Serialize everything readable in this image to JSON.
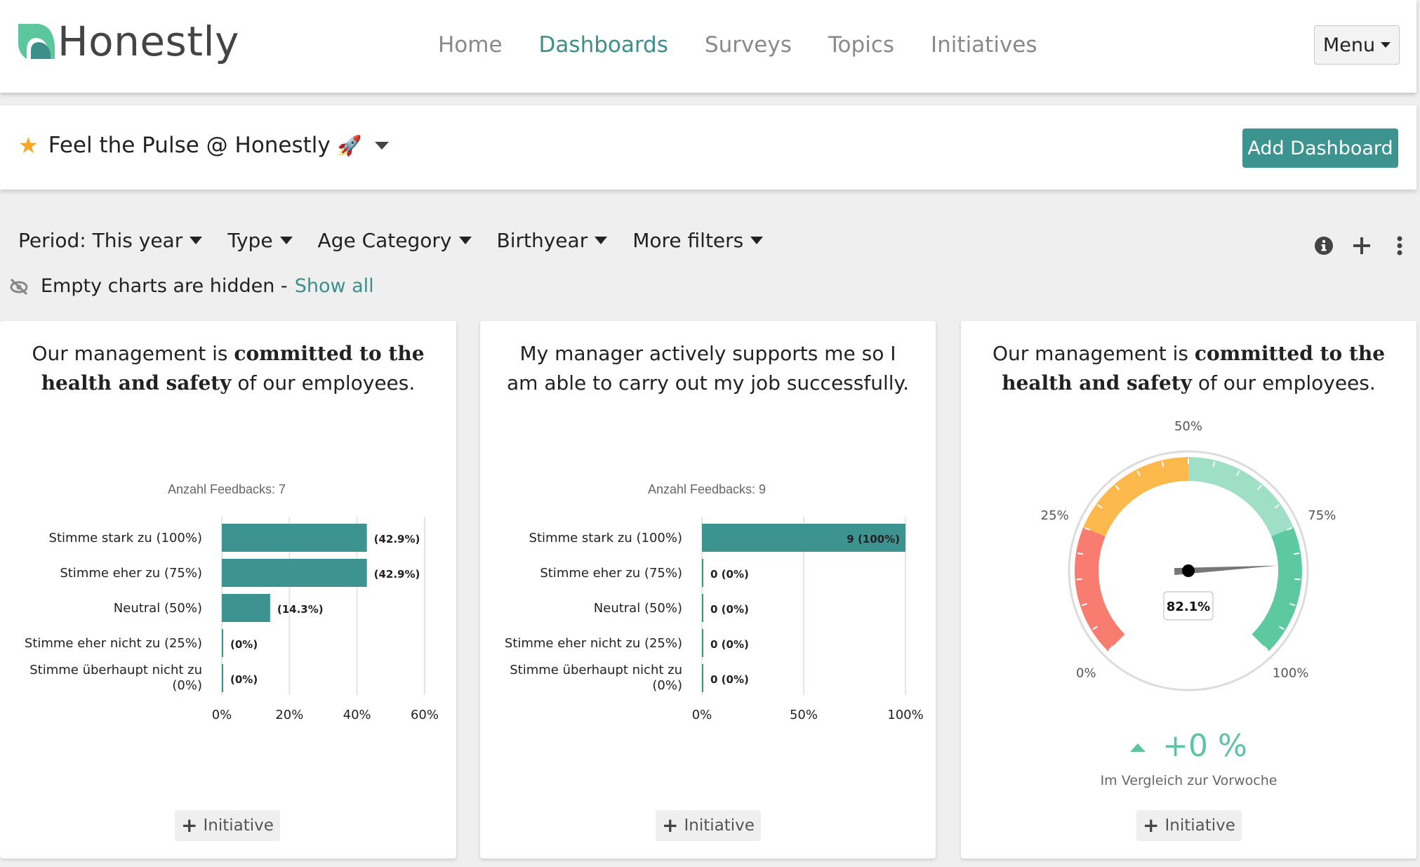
{
  "brand": {
    "name": "Honestly",
    "accent": "#3d9390",
    "logo_light": "#5cc79c",
    "logo_dark": "#3d8f8c"
  },
  "nav": {
    "links": [
      {
        "label": "Home",
        "active": false
      },
      {
        "label": "Dashboards",
        "active": true
      },
      {
        "label": "Surveys",
        "active": false
      },
      {
        "label": "Topics",
        "active": false
      },
      {
        "label": "Initiatives",
        "active": false
      }
    ],
    "menu_label": "Menu"
  },
  "dashboard": {
    "star_icon": "star-icon",
    "title": "Feel the Pulse @ Honestly",
    "emoji": "🚀",
    "add_label": "Add Dashboard"
  },
  "filters": [
    {
      "label": "Period: This year"
    },
    {
      "label": "Type"
    },
    {
      "label": "Age Category"
    },
    {
      "label": "Birthyear"
    },
    {
      "label": "More filters"
    }
  ],
  "tools": {
    "info_icon": "info-icon",
    "add_icon": "plus-icon",
    "more_icon": "more-vertical-icon"
  },
  "empty_note": {
    "text": "Empty charts are hidden -",
    "link": "Show all"
  },
  "cards": [
    {
      "title_pre": "Our management is ",
      "title_bold": "committed to the health and safety",
      "title_post": " of our employees.",
      "initiative_label": "Initiative"
    },
    {
      "title_pre": "My manager actively supports me so I am able to carry out my job successfully.",
      "title_bold": "",
      "title_post": "",
      "initiative_label": "Initiative"
    },
    {
      "title_pre": "Our management is ",
      "title_bold": "committed to the health and safety",
      "title_post": " of our employees.",
      "initiative_label": "Initiative",
      "trend_value": "+0 %",
      "trend_note": "Im Vergleich zur Vorwoche"
    }
  ],
  "chart_data": [
    {
      "type": "bar",
      "orientation": "horizontal",
      "title": "Anzahl Feedbacks: 7",
      "categories": [
        "Stimme stark zu (100%)",
        "Stimme eher zu (75%)",
        "Neutral (50%)",
        "Stimme eher nicht zu (25%)",
        "Stimme überhaupt nicht zu (0%)"
      ],
      "values": [
        42.9,
        42.9,
        14.3,
        0,
        0
      ],
      "data_labels": [
        "(42.9%)",
        "(42.9%)",
        "(14.3%)",
        "(0%)",
        "(0%)"
      ],
      "xticks": [
        "0%",
        "20%",
        "40%",
        "60%"
      ],
      "xlim": [
        0,
        60
      ],
      "grid": true,
      "color": "#3d9390"
    },
    {
      "type": "bar",
      "orientation": "horizontal",
      "title": "Anzahl Feedbacks: 9",
      "categories": [
        "Stimme stark zu (100%)",
        "Stimme eher zu (75%)",
        "Neutral (50%)",
        "Stimme eher nicht zu (25%)",
        "Stimme überhaupt nicht zu (0%)"
      ],
      "values": [
        100,
        0,
        0,
        0,
        0
      ],
      "counts": [
        9,
        0,
        0,
        0,
        0
      ],
      "data_labels": [
        "9 (100%)",
        "0 (0%)",
        "0 (0%)",
        "0 (0%)",
        "0 (0%)"
      ],
      "xticks": [
        "0%",
        "50%",
        "100%"
      ],
      "xlim": [
        0,
        100
      ],
      "grid": true,
      "color": "#3d9390"
    },
    {
      "type": "gauge",
      "value": 82.1,
      "value_label": "82.1%",
      "range": [
        0,
        100
      ],
      "tick_labels": [
        "0%",
        "25%",
        "50%",
        "75%",
        "100%"
      ],
      "bands": [
        {
          "from": 0,
          "to": 25,
          "color": "#f87c6f"
        },
        {
          "from": 25,
          "to": 50,
          "color": "#fdb94b"
        },
        {
          "from": 50,
          "to": 75,
          "color": "#9edfc6"
        },
        {
          "from": 75,
          "to": 100,
          "color": "#5cc9a0"
        }
      ]
    }
  ]
}
